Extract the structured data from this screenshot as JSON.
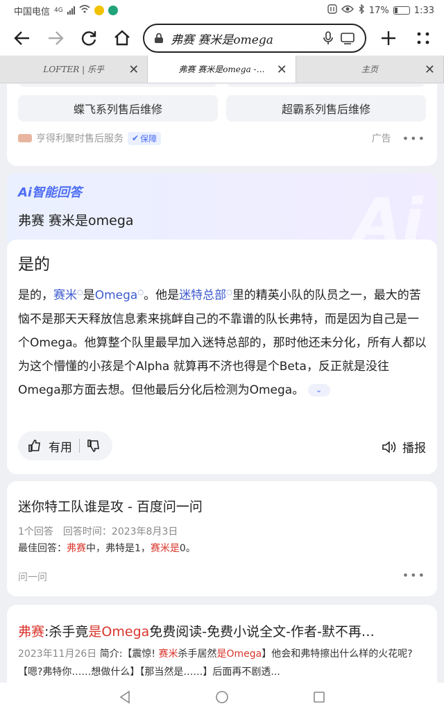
{
  "status": {
    "carrier": "中国电信",
    "network": "4G",
    "battery_pct": "17%",
    "time": "1:33"
  },
  "browser": {
    "url_text": "弗赛 赛米是omega",
    "tabs": [
      {
        "label": "LOFTER | 乐乎"
      },
      {
        "label": "弗赛 赛米是omega -…"
      },
      {
        "label": "主页"
      }
    ]
  },
  "ad_card": {
    "pill_left": "蝶飞系列售后维修",
    "pill_right": "超霸系列售后维修",
    "source": "亨得利聚时售后服务",
    "badge": "保障",
    "ad_label": "广告"
  },
  "ai": {
    "logo": "Ai智能回答",
    "question": "弗赛 赛米是omega",
    "answer_title": "是的",
    "answer": {
      "p1": "是的，",
      "l1": "赛米",
      "p2": "是",
      "l2": "Omega",
      "p3": "。他是",
      "l3": "迷特总部",
      "p4": "里的精英小队的队员之一，最大的苦恼不是那天天释放信息素来挑衅自己的不靠谱的队长弗特，而是因为自己是一个Omega。他算整个队里最早加入迷特总部的，那时他还未分化，所有人都以为这个懵懂的小孩是个Alpha 就算再不济也得是个Beta，反正就是没往Omega那方面去想。但他最后分化后检测为Omega。"
    },
    "useful_label": "有用",
    "play_label": "播报"
  },
  "result1": {
    "title": "迷你特工队谁是攻 - 百度问一问",
    "meta": "1个回答　回答时间：2023年8月3日",
    "snip_pre": "最佳回答：",
    "snip_hl1": "弗赛",
    "snip_mid": "中，弗特是1，",
    "snip_hl2": "赛米是",
    "snip_end": "0。",
    "source": "问一问"
  },
  "result2": {
    "t_hl1": "弗赛",
    "t1": ":杀手竟",
    "t_hl2": "是Omega",
    "t2": "免费阅读-免费小说全文-作者-默不再…",
    "date": "2023年11月26日",
    "s1": "简介:【震惊! ",
    "s_hl1": "赛米",
    "s2": "杀手居然",
    "s_hl2": "是Omega",
    "s3": "】他会和弗特擦出什么样的火花呢?【嗯?弗特你……想做什么】【那当然是……】后面再不剧透..."
  }
}
